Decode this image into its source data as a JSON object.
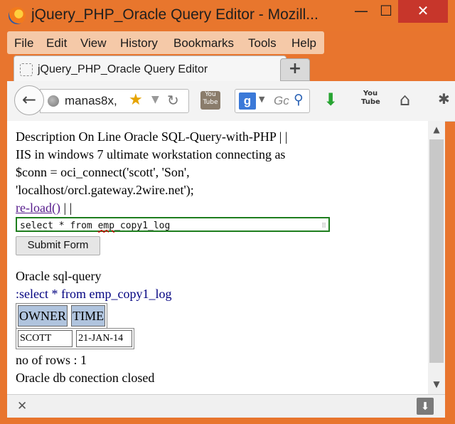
{
  "window": {
    "title": "jQuery_PHP_Oracle Query Editor - Mozill...",
    "min_label": "—",
    "max_label": "☐",
    "close_label": "✕"
  },
  "menu": [
    "File",
    "Edit",
    "View",
    "History",
    "Bookmarks",
    "Tools",
    "Help"
  ],
  "tab": {
    "title": "jQuery_PHP_Oracle Query Editor",
    "new_tab_label": "+"
  },
  "nav": {
    "back_label": "←",
    "url": "manas8x,",
    "search_engine_letter": "g",
    "search_placeholder": "Gc"
  },
  "page": {
    "line1": "Description On Line Oracle SQL-Query-with-PHP | |",
    "line2": "IIS in windows 7 ultimate workstation connecting as",
    "line3": "$conn = oci_connect('scott', 'Son',",
    "line4": "'localhost/orcl.gateway.2wire.net');",
    "reload_link": "re-load()",
    "reload_suffix": " | |",
    "query_prefix": "select * from ",
    "query_squiggle": "emp",
    "query_suffix": "_copy1_log",
    "submit_label": "Submit Form",
    "sql_heading": "Oracle sql-query",
    "sql_echo": ":select * from emp_copy1_log",
    "table_headers": [
      "OWNER",
      "TIME"
    ],
    "table_rows": [
      [
        "SCOTT",
        "21-JAN-14"
      ]
    ],
    "rows_count": "no of rows : 1",
    "closed_msg": "Oracle db conection closed"
  }
}
